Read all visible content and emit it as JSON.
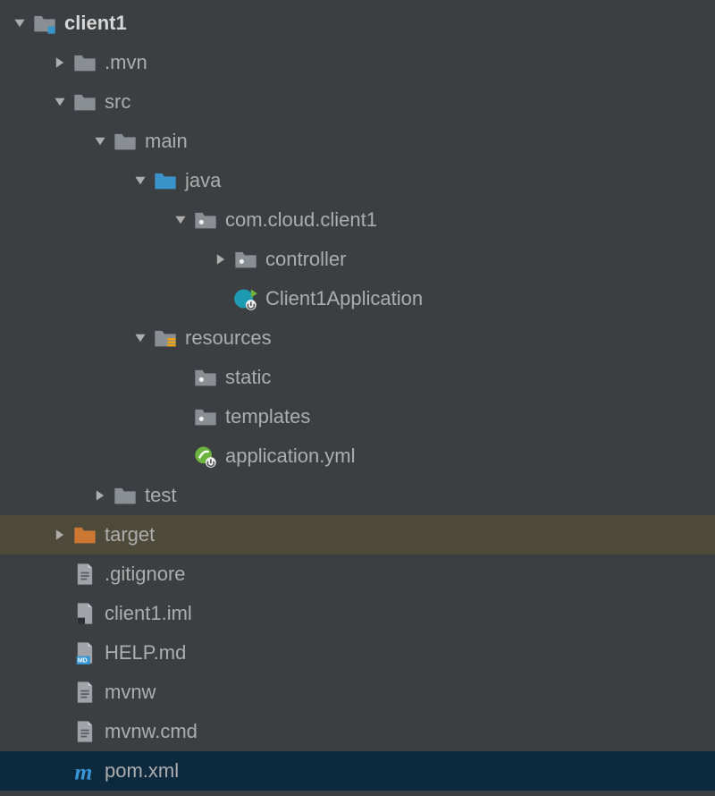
{
  "tree": {
    "indentStep": 45,
    "baseIndent": 8,
    "items": [
      {
        "id": "client1",
        "label": "client1",
        "depth": 0,
        "expand": "open",
        "icon": "folder-module",
        "bold": true
      },
      {
        "id": "mvn",
        "label": ".mvn",
        "depth": 1,
        "expand": "closed",
        "icon": "folder-gray"
      },
      {
        "id": "src",
        "label": "src",
        "depth": 1,
        "expand": "open",
        "icon": "folder-gray"
      },
      {
        "id": "main",
        "label": "main",
        "depth": 2,
        "expand": "open",
        "icon": "folder-gray"
      },
      {
        "id": "java",
        "label": "java",
        "depth": 3,
        "expand": "open",
        "icon": "folder-source"
      },
      {
        "id": "pkg",
        "label": "com.cloud.client1",
        "depth": 4,
        "expand": "open",
        "icon": "package"
      },
      {
        "id": "controller",
        "label": "controller",
        "depth": 5,
        "expand": "closed",
        "icon": "package"
      },
      {
        "id": "app",
        "label": "Client1Application",
        "depth": 5,
        "expand": "none",
        "icon": "spring-run"
      },
      {
        "id": "resources",
        "label": "resources",
        "depth": 3,
        "expand": "open",
        "icon": "folder-resources"
      },
      {
        "id": "static",
        "label": "static",
        "depth": 4,
        "expand": "none",
        "icon": "package"
      },
      {
        "id": "templates",
        "label": "templates",
        "depth": 4,
        "expand": "none",
        "icon": "package"
      },
      {
        "id": "appyml",
        "label": "application.yml",
        "depth": 4,
        "expand": "none",
        "icon": "spring-file"
      },
      {
        "id": "test",
        "label": "test",
        "depth": 2,
        "expand": "closed",
        "icon": "folder-gray"
      },
      {
        "id": "target",
        "label": "target",
        "depth": 1,
        "expand": "closed",
        "icon": "folder-orange",
        "rowClass": "row-target"
      },
      {
        "id": "gitignore",
        "label": ".gitignore",
        "depth": 1,
        "expand": "none",
        "icon": "file"
      },
      {
        "id": "iml",
        "label": "client1.iml",
        "depth": 1,
        "expand": "none",
        "icon": "file-dot"
      },
      {
        "id": "help",
        "label": "HELP.md",
        "depth": 1,
        "expand": "none",
        "icon": "file-md"
      },
      {
        "id": "mvnw",
        "label": "mvnw",
        "depth": 1,
        "expand": "none",
        "icon": "file"
      },
      {
        "id": "mvnwcmd",
        "label": "mvnw.cmd",
        "depth": 1,
        "expand": "none",
        "icon": "file"
      },
      {
        "id": "pom",
        "label": "pom.xml",
        "depth": 1,
        "expand": "none",
        "icon": "maven",
        "rowClass": "row-selected"
      }
    ]
  },
  "colors": {
    "folderGray": "#8a8f94",
    "folderBlue": "#3a93c9",
    "folderOrange": "#cc7832",
    "file": "#a0a4a8",
    "mavenBlue": "#3795d6",
    "springGreen": "#6db33f",
    "yellow": "#f0a30a"
  }
}
